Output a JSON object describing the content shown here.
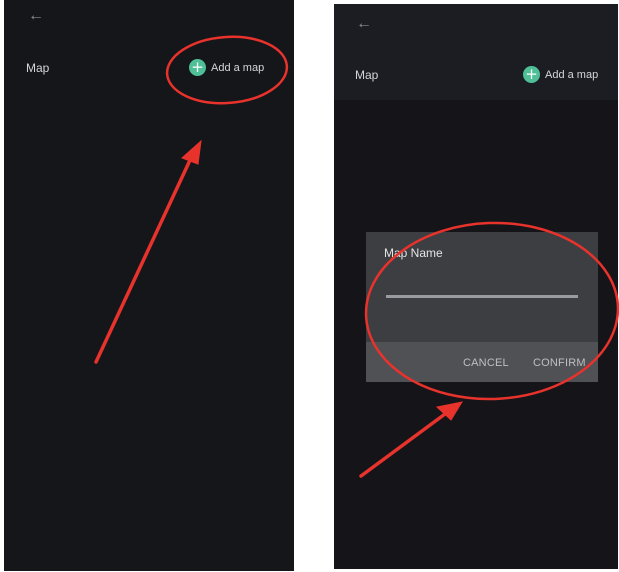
{
  "left_screen": {
    "back_icon": "arrow-left",
    "title": "Map",
    "add_button": {
      "icon": "plus",
      "label": "Add a map"
    }
  },
  "right_screen": {
    "back_icon": "arrow-left",
    "title": "Map",
    "add_button": {
      "icon": "plus",
      "label": "Add a map"
    },
    "dialog": {
      "title": "Map Name",
      "input_value": "",
      "cancel_label": "CANCEL",
      "confirm_label": "CONFIRM"
    }
  },
  "colors": {
    "screen_bg": "#15161a",
    "accent_green": "#4fbf97",
    "annotation_red": "#e8322c",
    "dialog_bg": "#3d3e42"
  }
}
